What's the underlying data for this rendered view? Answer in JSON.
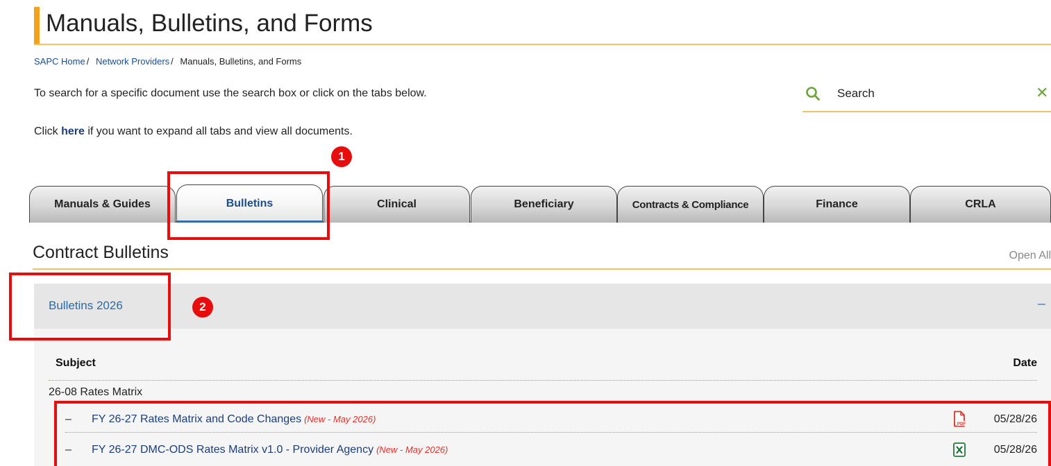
{
  "page": {
    "title": "Manuals, Bulletins, and Forms"
  },
  "breadcrumb": {
    "items": [
      {
        "label": "SAPC Home"
      },
      {
        "label": "Network Providers"
      },
      {
        "label": "Manuals, Bulletins, and Forms"
      }
    ],
    "separator": "/"
  },
  "intro": {
    "search_text": "To search for a specific document use the search box or click on the tabs below.",
    "expand_prefix": "Click ",
    "expand_link": "here",
    "expand_suffix": " if you want to expand all tabs and view all documents."
  },
  "search": {
    "placeholder": "Search",
    "icon": "search-icon",
    "clear_label": "✕"
  },
  "tabs": [
    {
      "label": "Manuals & Guides",
      "active": false
    },
    {
      "label": "Bulletins",
      "active": true
    },
    {
      "label": "Clinical",
      "active": false
    },
    {
      "label": "Beneficiary",
      "active": false
    },
    {
      "label": "Contracts & Compliance",
      "active": false
    },
    {
      "label": "Finance",
      "active": false
    },
    {
      "label": "CRLA",
      "active": false
    }
  ],
  "section": {
    "title": "Contract Bulletins",
    "open_all": "Open All"
  },
  "accordion": {
    "title": "Bulletins 2026",
    "toggle": "–",
    "columns": {
      "subject": "Subject",
      "date": "Date"
    },
    "groups": [
      {
        "label": "26-08 Rates Matrix",
        "documents": [
          {
            "dash": "–",
            "title": "FY 26-27 Rates Matrix and Code Changes",
            "badge": "(New - May 2026)",
            "file_type": "pdf",
            "date": "05/28/26"
          },
          {
            "dash": "–",
            "title": "FY 26-27 DMC-ODS Rates Matrix v1.0 - Provider Agency",
            "badge": "(New - May 2026)",
            "file_type": "xlsx",
            "date": "05/28/26"
          }
        ]
      }
    ]
  },
  "annotations": [
    {
      "label": "1",
      "color": "#e80c0c"
    },
    {
      "label": "2",
      "color": "#e80c0c"
    }
  ],
  "colors": {
    "accent": "#f5a21b",
    "link": "#1a4d8c",
    "new_badge": "#e0302a",
    "annotation": "#e80c0c",
    "search_icon": "#6aa636"
  }
}
